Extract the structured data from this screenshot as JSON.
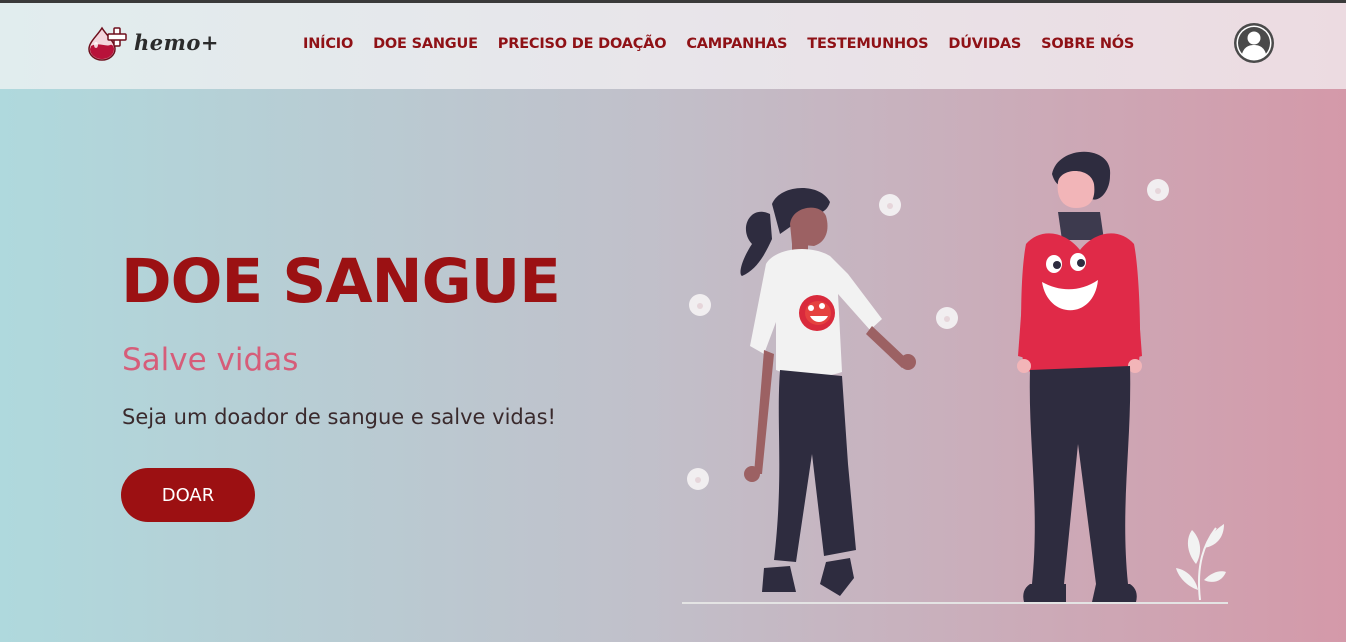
{
  "header": {
    "logo_text": "hemo+",
    "nav": [
      {
        "label": "INÍCIO"
      },
      {
        "label": "DOE SANGUE"
      },
      {
        "label": "PRECISO DE DOAÇÃO"
      },
      {
        "label": "CAMPANHAS"
      },
      {
        "label": "TESTEMUNHOS"
      },
      {
        "label": "DÚVIDAS"
      },
      {
        "label": "SOBRE NÓS"
      }
    ],
    "avatar_icon": "user-avatar-icon"
  },
  "hero": {
    "title": "DOE SANGUE",
    "subtitle": "Salve vidas",
    "text": "Seja um doador de sangue e salve vidas!",
    "cta_label": "DOAR"
  },
  "colors": {
    "brand": "#9b1113",
    "nav_text": "#8f1116",
    "subtitle": "#d65d79",
    "shirt_red": "#e02a48"
  }
}
